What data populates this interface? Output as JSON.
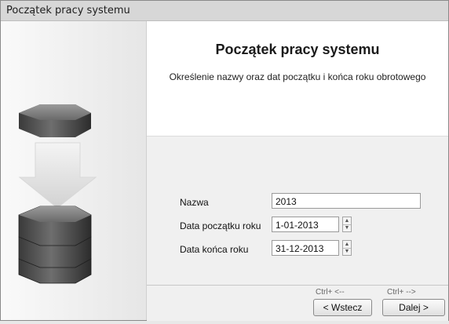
{
  "window": {
    "title": "Początek pracy systemu"
  },
  "main": {
    "heading": "Początek pracy systemu",
    "subtitle": "Określenie nazwy oraz dat początku i końca roku obrotowego"
  },
  "form": {
    "name_label": "Nazwa",
    "name_value": "2013",
    "start_label": "Data początku roku",
    "start_value": "1-01-2013",
    "end_label": "Data końca roku",
    "end_value": "31-12-2013"
  },
  "buttons": {
    "back_hint": "Ctrl+ <--",
    "back_label": "< Wstecz",
    "next_hint": "Ctrl+ -->",
    "next_label": "Dalej >"
  },
  "icons": {
    "source": "database-icon",
    "arrow": "arrow-down-icon",
    "target": "database-stack-icon"
  }
}
